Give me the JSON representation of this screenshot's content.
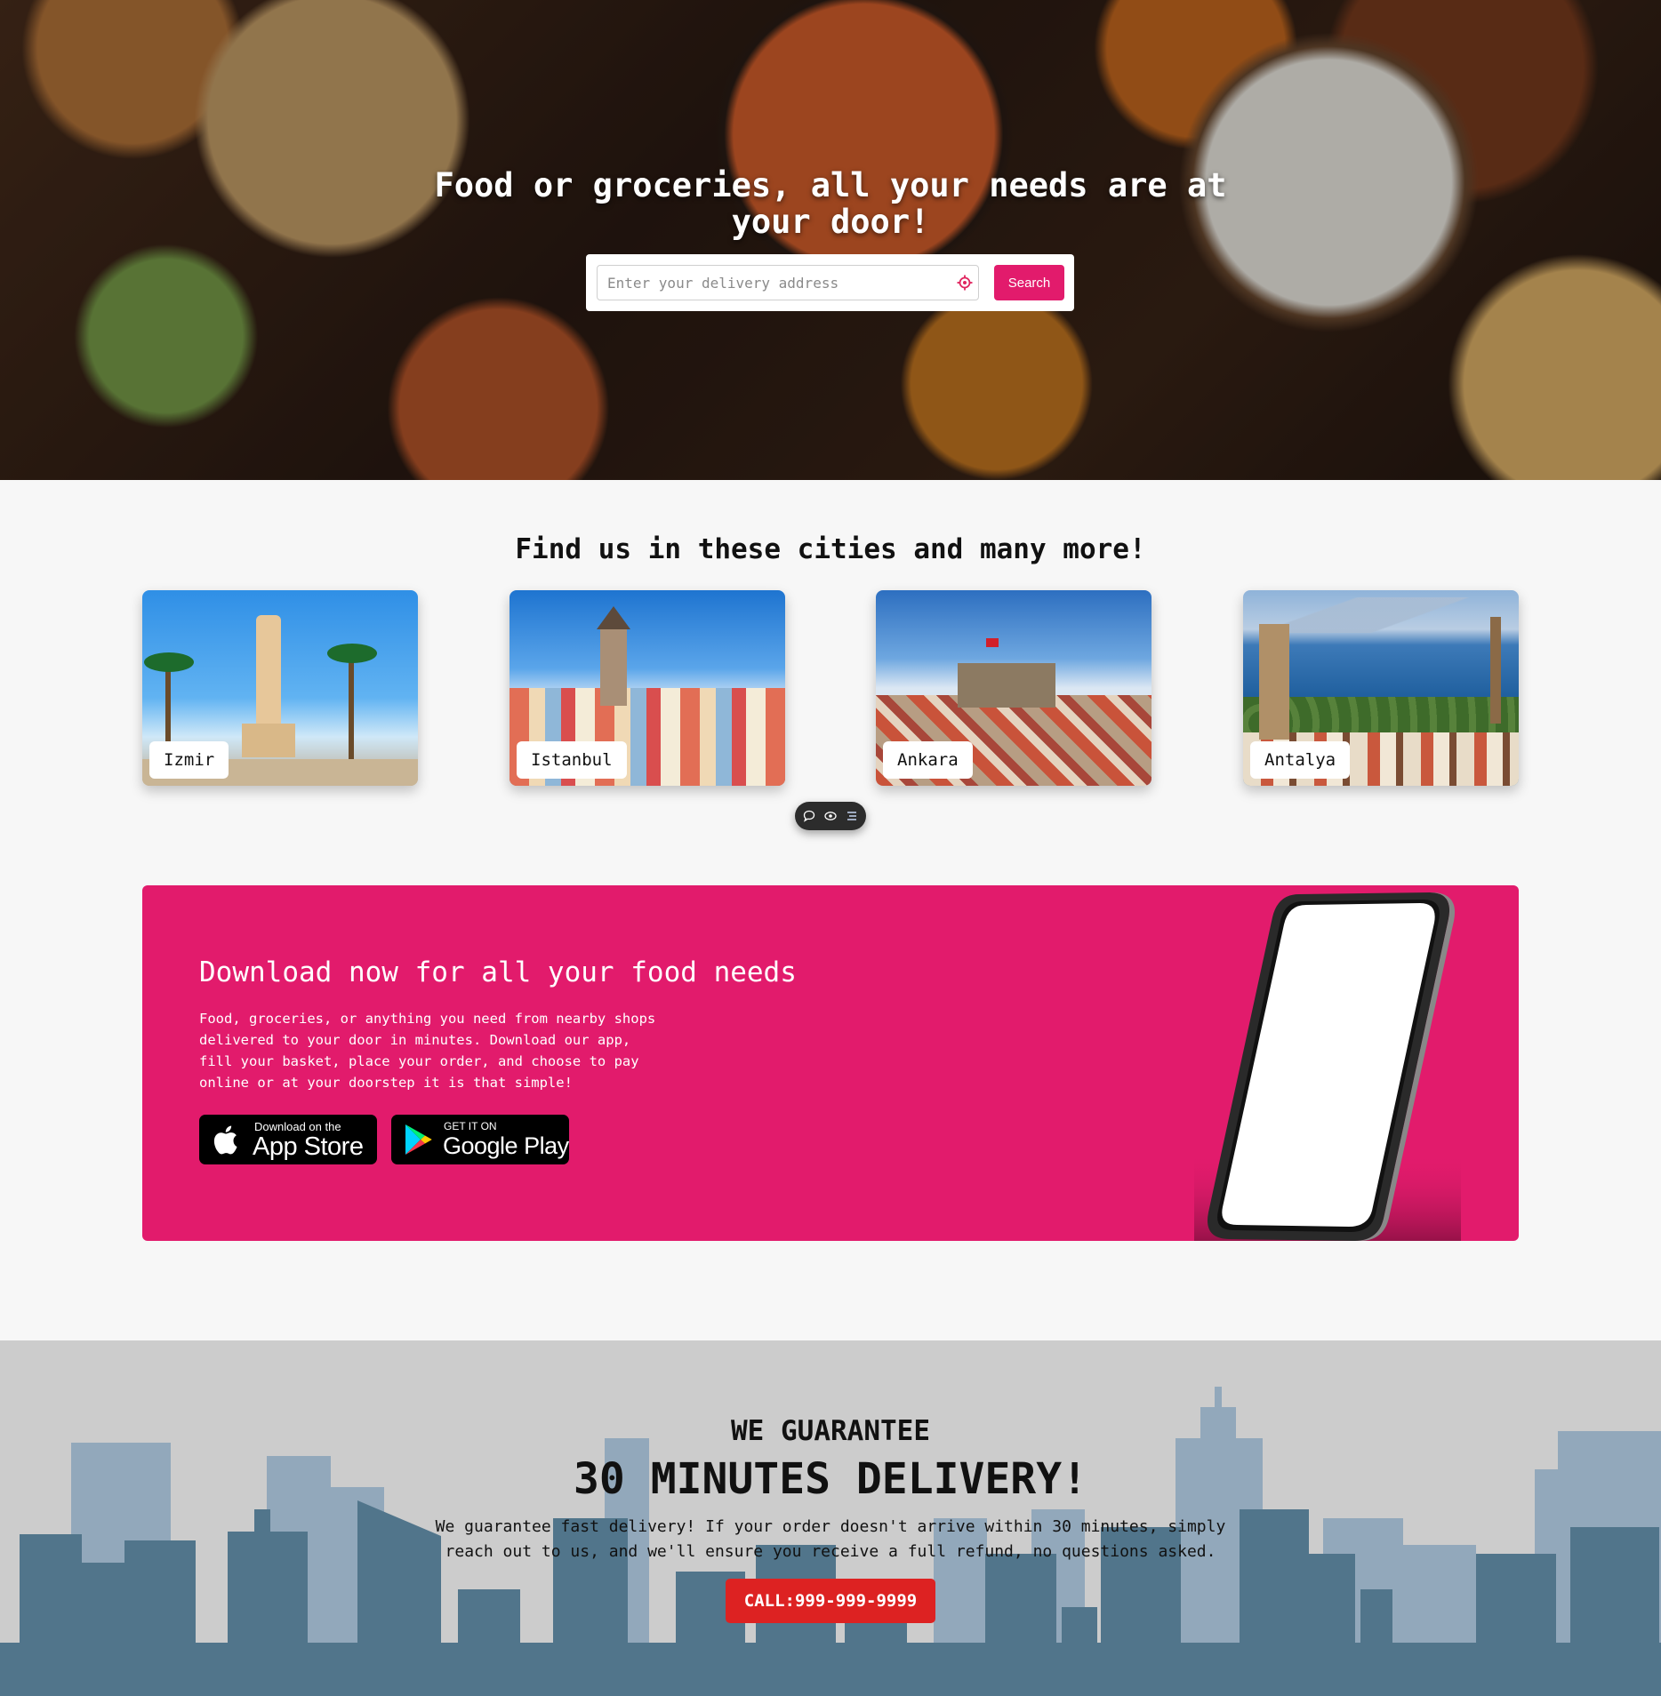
{
  "hero": {
    "title": "Food or groceries, all your needs are at your door!",
    "address_placeholder": "Enter your delivery address",
    "address_value": "",
    "location_icon": "location-target-icon",
    "search_label": "Search"
  },
  "cities": {
    "title": "Find us in these cities and many more!",
    "items": [
      {
        "name": "Izmir"
      },
      {
        "name": "Istanbul"
      },
      {
        "name": "Ankara"
      },
      {
        "name": "Antalya"
      }
    ]
  },
  "toolbar": {
    "icons": [
      "comment-icon",
      "eye-icon",
      "list-icon"
    ]
  },
  "promo": {
    "title": "Download now for all your food needs",
    "text": "Food, groceries, or anything you need from nearby shops delivered to your door in minutes. Download our app, fill your basket, place your order, and choose to pay online or at your doorstep it is that simple!",
    "app_store": {
      "small": "Download on the",
      "big": "App Store"
    },
    "google_play": {
      "small": "GET IT ON",
      "big": "Google Play"
    }
  },
  "guarantee": {
    "subtitle": "WE GUARANTEE",
    "title": "30 MINUTES DELIVERY!",
    "text": "We guarantee fast delivery! If your order doesn't arrive within 30 minutes, simply reach out to us, and we'll ensure you receive a full refund, no questions asked.",
    "call_label": "CALL:999-999-9999"
  },
  "colors": {
    "brand_pink": "#e21b6c",
    "call_red": "#dd2222",
    "skyline_dark": "#51758b",
    "skyline_light": "#92a8bb"
  }
}
